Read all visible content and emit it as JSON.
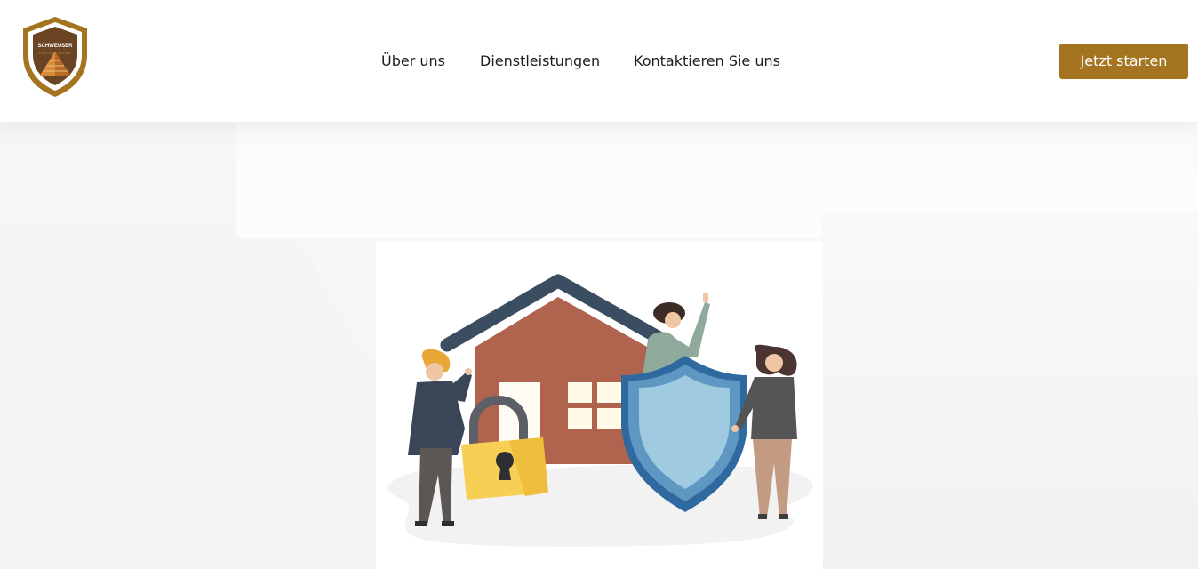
{
  "header": {
    "logo": {
      "name": "schweuser-security-logo",
      "text": "SCHWEUSER"
    },
    "nav": [
      {
        "label": "Über uns"
      },
      {
        "label": "Dienstleistungen"
      },
      {
        "label": "Kontaktieren Sie uns"
      }
    ],
    "cta_label": "Jetzt starten"
  },
  "colors": {
    "accent": "#a57420",
    "house_wall": "#b0644e",
    "roof": "#3b4d60",
    "shield_outer": "#2e6aa0",
    "shield_inner": "#9fcae0",
    "lock_body": "#f7cf54"
  },
  "hero": {
    "illustration": "home-security-illustration"
  }
}
